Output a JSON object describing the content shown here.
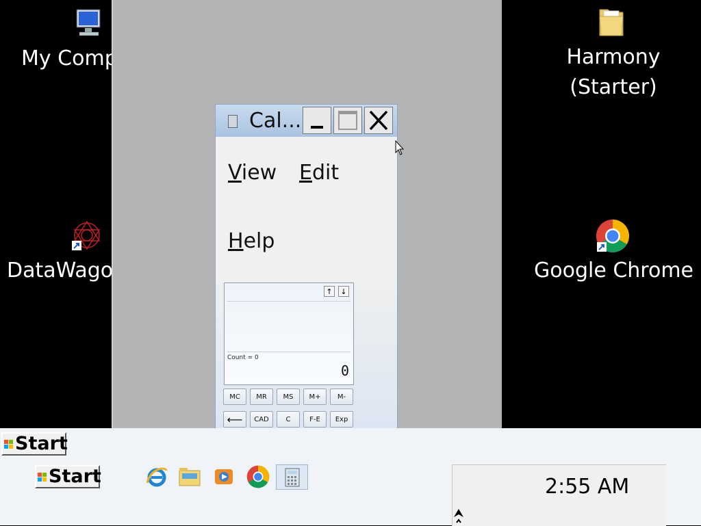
{
  "desktop": {
    "icons": [
      {
        "name": "My Computer",
        "label": "My Comp"
      },
      {
        "name": "DataWagon",
        "label": "DataWago"
      },
      {
        "name": "Harmony (Starter)",
        "label_line1": "Harmony",
        "label_line2": "(Starter)"
      },
      {
        "name": "Google Chrome",
        "label": "Google Chrome"
      }
    ]
  },
  "calculator": {
    "title": "Cal...",
    "menu": {
      "view": "V",
      "view_rest": "iew",
      "edit": "E",
      "edit_rest": "dit",
      "help": "H",
      "help_rest": "elp"
    },
    "history_up": "↑",
    "history_down": "↓",
    "count_text": "Count = 0",
    "display_value": "0",
    "row1": [
      "MC",
      "MR",
      "MS",
      "M+",
      "M-"
    ],
    "row2": [
      "⟵",
      "CAD",
      "C",
      "F-E",
      "Exp"
    ]
  },
  "taskbar": {
    "start_label": "Start",
    "start_label_2": "Start",
    "pinned": [
      "internet-explorer-icon",
      "file-explorer-icon",
      "media-player-icon",
      "chrome-icon",
      "calculator-icon"
    ],
    "clock": "2:55 AM"
  },
  "colors": {
    "desktop": "#000000",
    "panel": "#b4b4b4",
    "taskbar": "#f0f3f7"
  }
}
